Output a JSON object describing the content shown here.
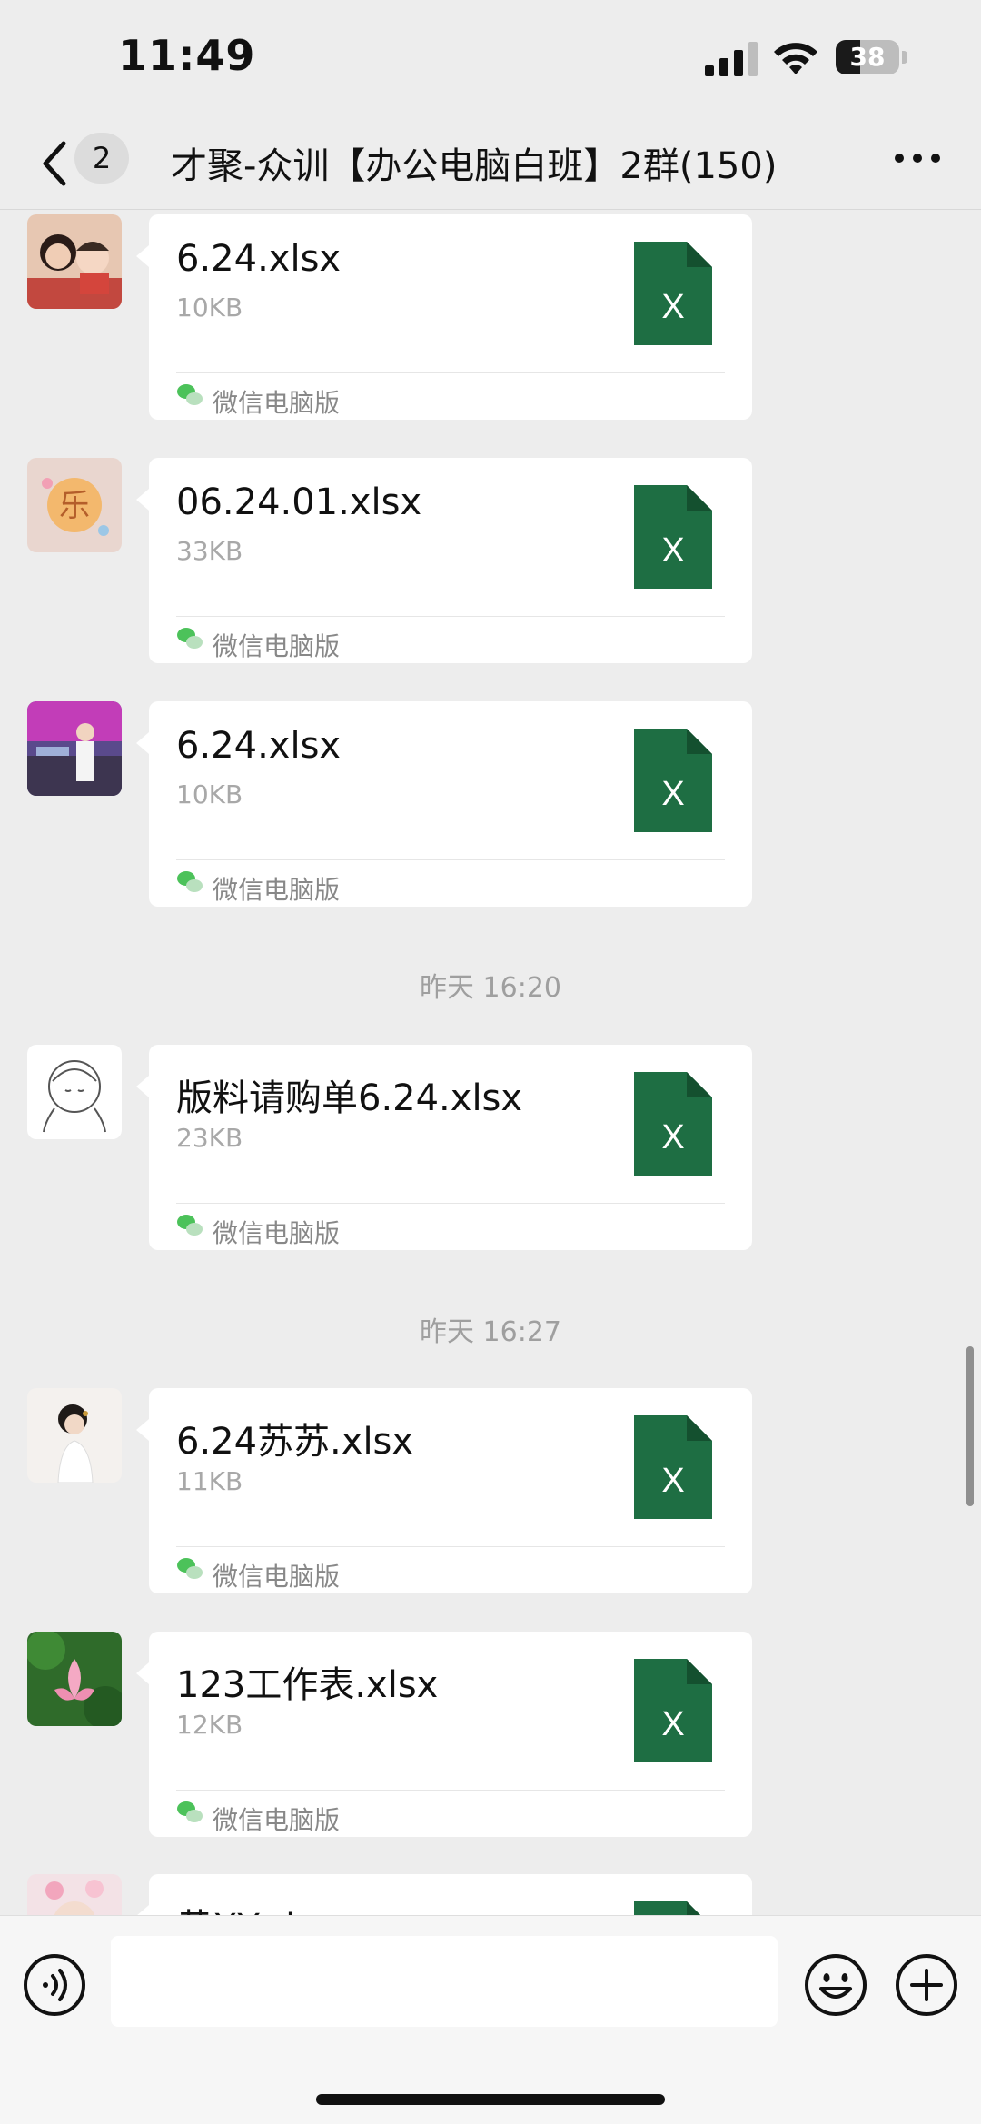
{
  "status_bar": {
    "time": "11:49",
    "battery_level": "38",
    "icons": [
      "signal-icon",
      "wifi-icon",
      "battery-icon"
    ]
  },
  "nav": {
    "unread_count": "2",
    "title": "才聚-众训【办公电脑白班】2群(150)",
    "icons": [
      "back-arrow-icon",
      "more-icon"
    ]
  },
  "messages": [
    {
      "file_name": "6.24.xlsx",
      "file_size": "10KB",
      "source": "微信电脑版",
      "avatar": "avatar-mother-child"
    },
    {
      "file_name": "06.24.01.xlsx",
      "file_size": "33KB",
      "source": "微信电脑版",
      "avatar": "avatar-cartoon"
    },
    {
      "file_name": "6.24.xlsx",
      "file_size": "10KB",
      "source": "微信电脑版",
      "avatar": "avatar-woman-office"
    },
    {
      "time_divider": "昨天 16:20"
    },
    {
      "file_name": "版料请购单6.24.xlsx",
      "file_size": "23KB",
      "source": "微信电脑版",
      "avatar": "avatar-sketch-girl"
    },
    {
      "time_divider": "昨天 16:27"
    },
    {
      "file_name": "6.24苏苏.xlsx",
      "file_size": "11KB",
      "source": "微信电脑版",
      "avatar": "avatar-woman-white"
    },
    {
      "file_name": "123工作表.xlsx",
      "file_size": "12KB",
      "source": "微信电脑版",
      "avatar": "avatar-lotus"
    },
    {
      "file_name": "黄XY.xlsx",
      "file_size": "",
      "source": "",
      "avatar": "avatar-girl-flowers"
    }
  ],
  "input_bar": {
    "placeholder": "",
    "icons": [
      "voice-icon",
      "emoji-icon",
      "plus-icon"
    ]
  },
  "colors": {
    "background": "#ededed",
    "bubble": "#ffffff",
    "excel_green": "#1e6e43",
    "wechat_green": "#4cc25a"
  }
}
